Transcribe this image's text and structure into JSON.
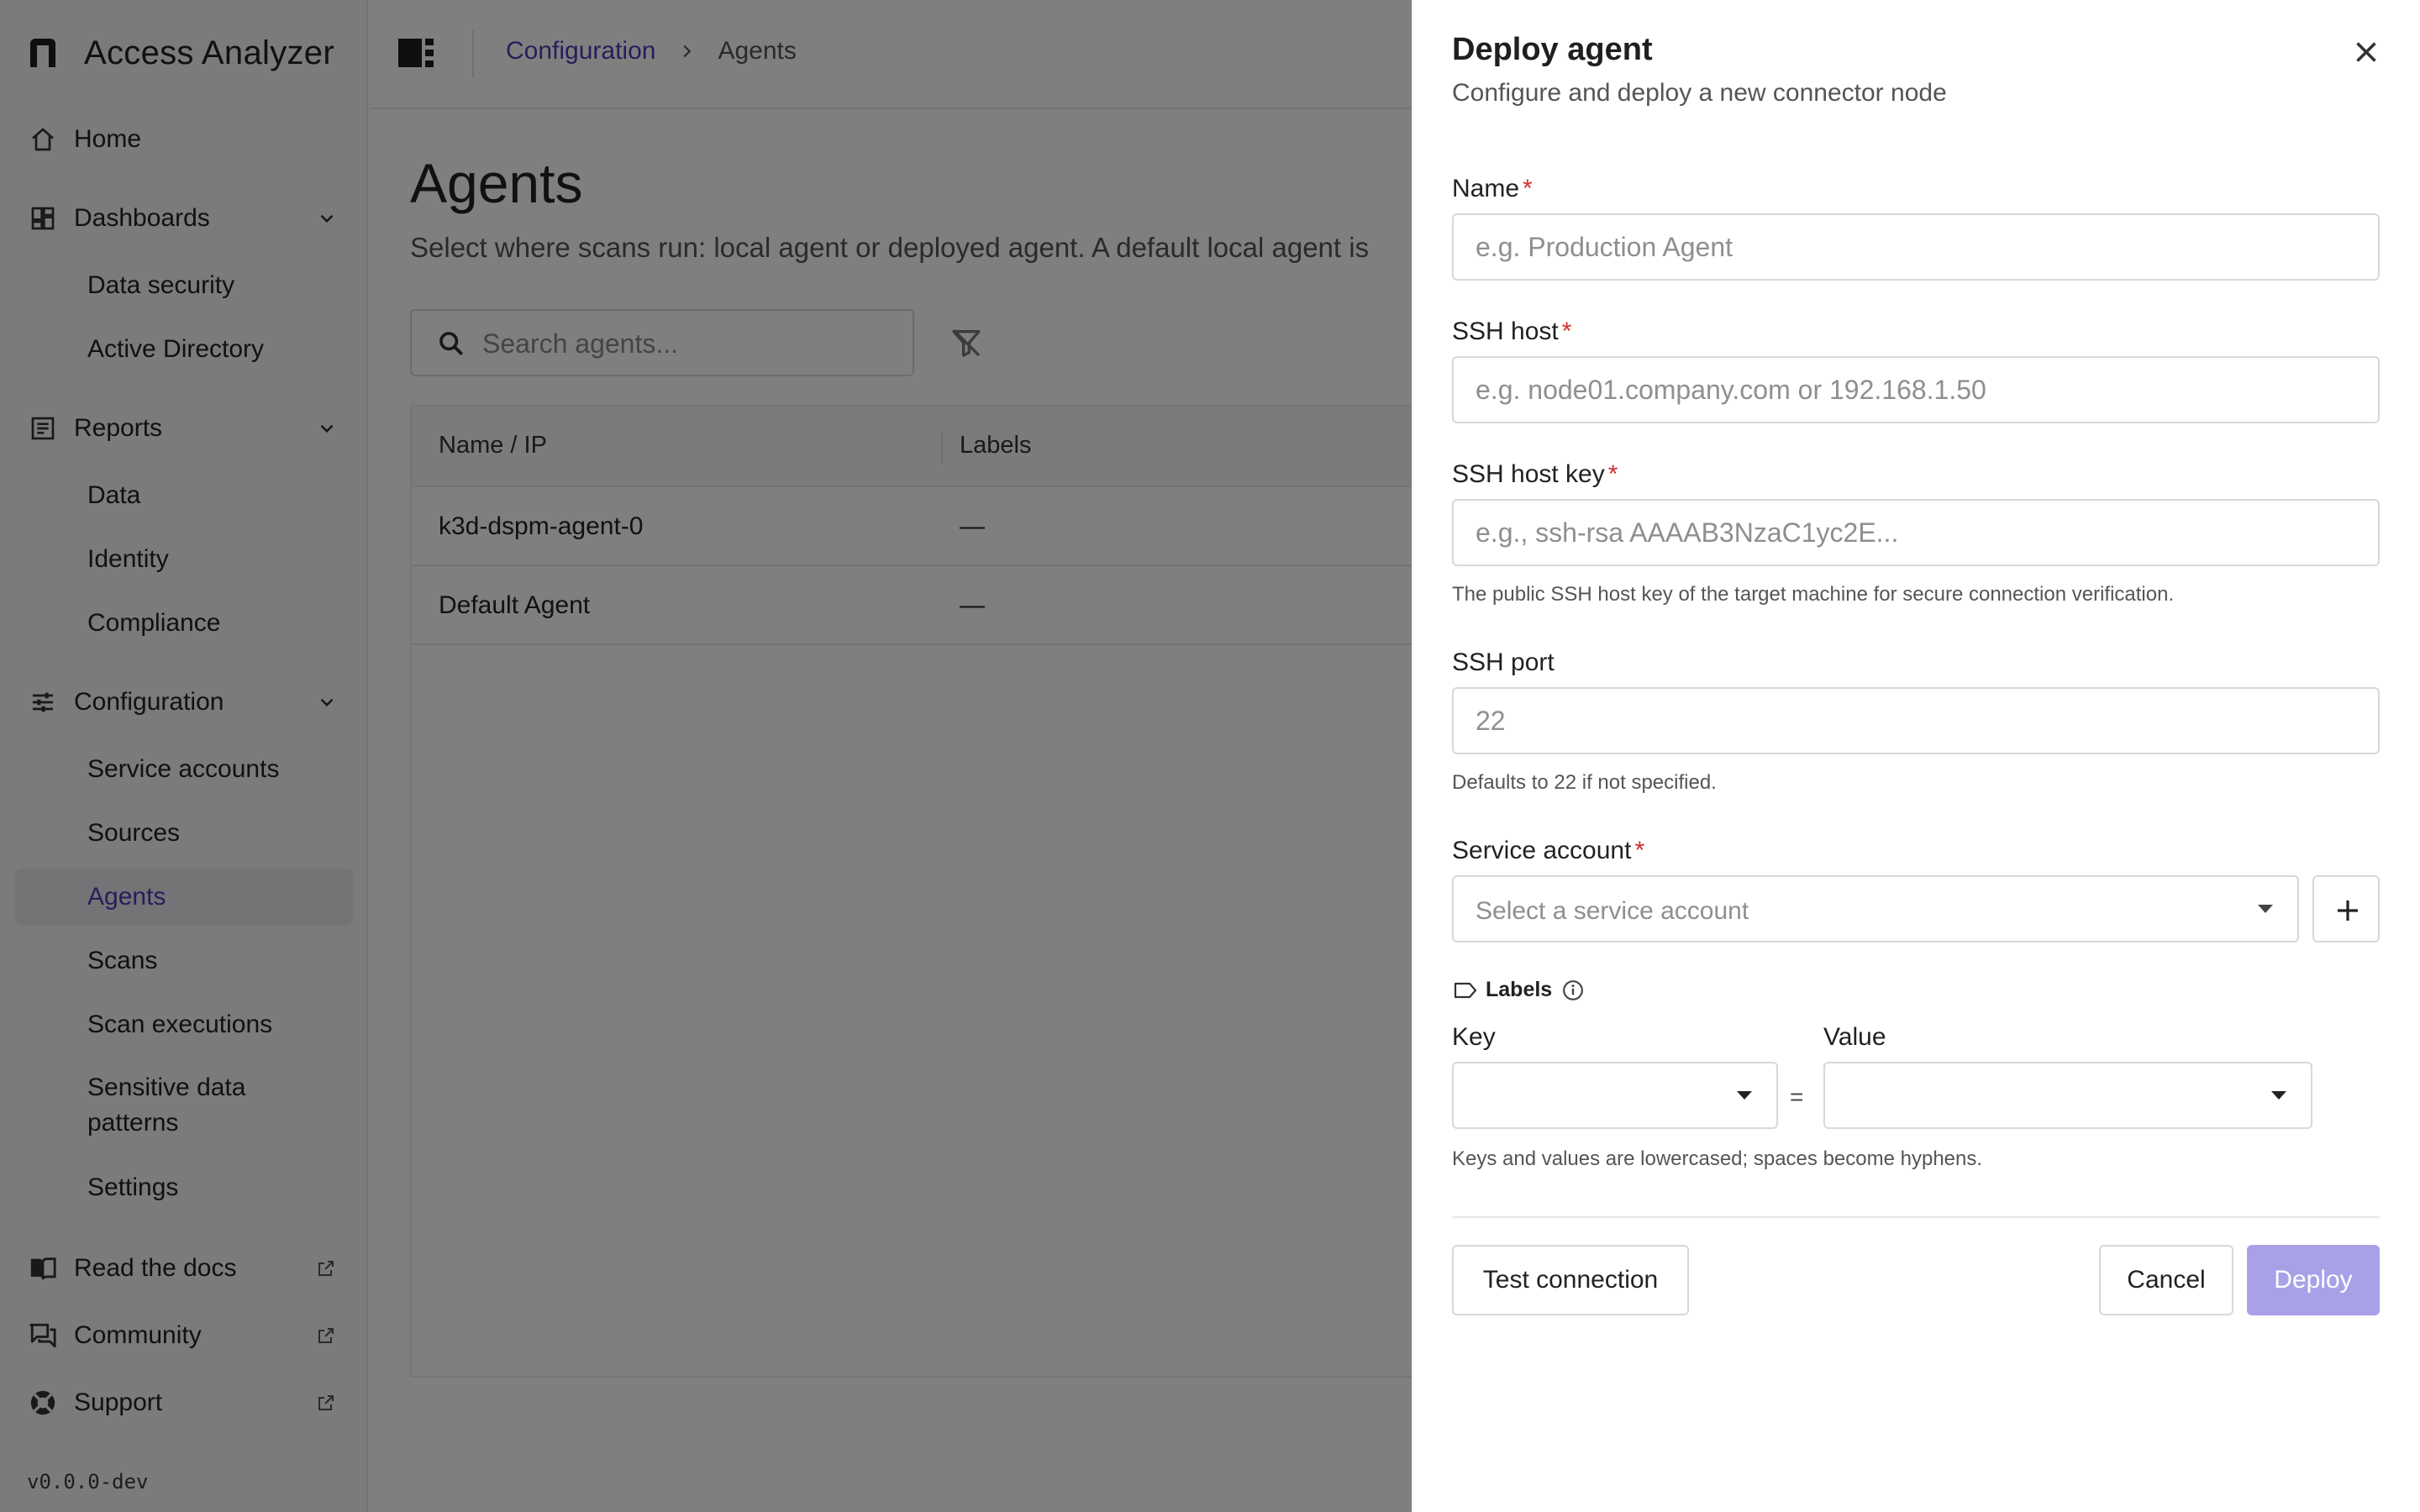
{
  "app": {
    "name": "Access Analyzer",
    "version": "v0.0.0-dev"
  },
  "sidebar": {
    "home": "Home",
    "dashboards": {
      "label": "Dashboards",
      "items": [
        "Data security",
        "Active Directory"
      ]
    },
    "reports": {
      "label": "Reports",
      "items": [
        "Data",
        "Identity",
        "Compliance"
      ]
    },
    "configuration": {
      "label": "Configuration",
      "items": [
        "Service accounts",
        "Sources",
        "Agents",
        "Scans",
        "Scan executions",
        "Sensitive data patterns",
        "Settings"
      ],
      "active": "Agents"
    },
    "links": [
      "Read the docs",
      "Community",
      "Support"
    ]
  },
  "breadcrumb": {
    "parent": "Configuration",
    "current": "Agents"
  },
  "page": {
    "title": "Agents",
    "subtitle": "Select where scans run: local agent or deployed agent. A default local agent is",
    "search_placeholder": "Search agents..."
  },
  "table": {
    "columns": [
      "Name / IP",
      "Labels"
    ],
    "rows": [
      {
        "name": "k3d-dspm-agent-0",
        "labels": "—"
      },
      {
        "name": "Default Agent",
        "labels": "—"
      }
    ]
  },
  "drawer": {
    "title": "Deploy agent",
    "subtitle": "Configure and deploy a new connector node",
    "required_mark": "*",
    "fields": {
      "name": {
        "label": "Name",
        "placeholder": "e.g. Production Agent"
      },
      "ssh_host": {
        "label": "SSH host",
        "placeholder": "e.g. node01.company.com or 192.168.1.50"
      },
      "ssh_host_key": {
        "label": "SSH host key",
        "placeholder": "e.g., ssh-rsa AAAAB3NzaC1yc2E...",
        "help": "The public SSH host key of the target machine for secure connection verification."
      },
      "ssh_port": {
        "label": "SSH port",
        "placeholder": "22",
        "help": "Defaults to 22 if not specified."
      },
      "service_account": {
        "label": "Service account",
        "placeholder": "Select a service account"
      }
    },
    "labels": {
      "heading": "Labels",
      "key_label": "Key",
      "value_label": "Value",
      "separator": "=",
      "help": "Keys and values are lowercased; spaces become hyphens."
    },
    "buttons": {
      "test": "Test connection",
      "cancel": "Cancel",
      "deploy": "Deploy"
    }
  },
  "colors": {
    "accent": "#4b3fb8",
    "deploy_disabled": "#a9a1e8",
    "required": "#d32f2f"
  }
}
